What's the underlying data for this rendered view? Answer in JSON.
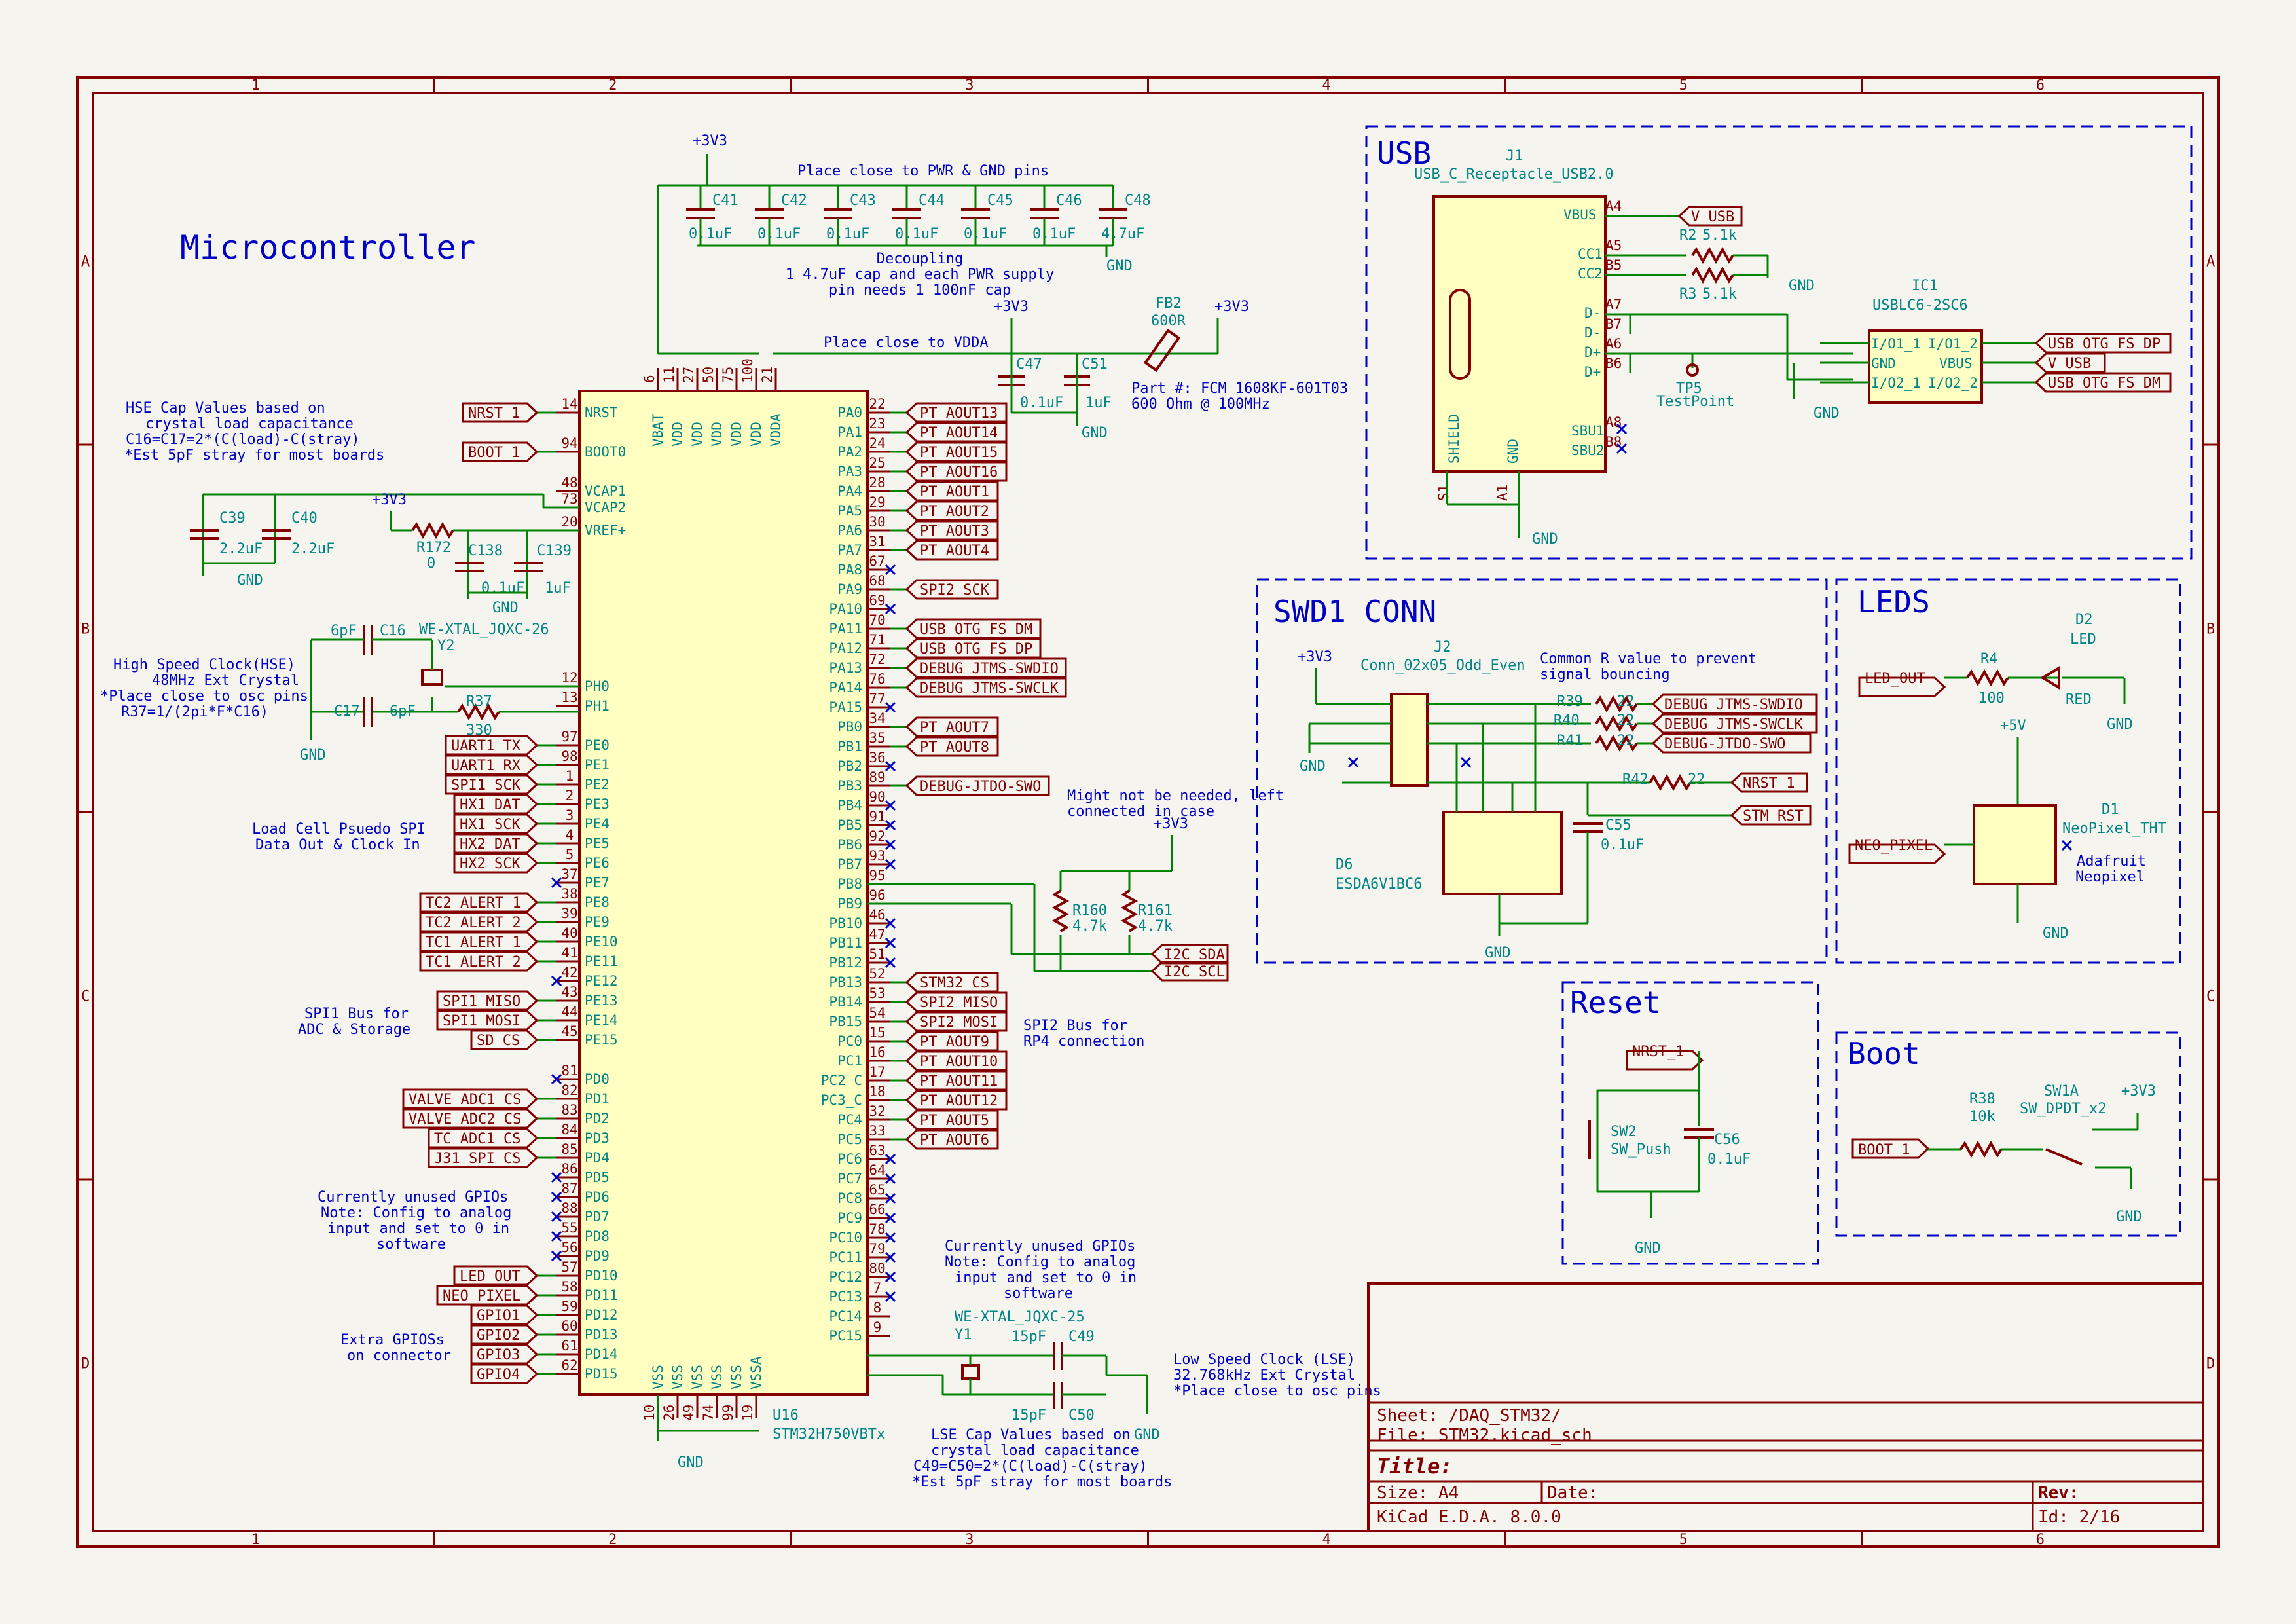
{
  "sheet": {
    "title": "Microcontroller",
    "sheet_line": "Sheet: /DAQ_STM32/",
    "file_line": "File: STM32.kicad_sch",
    "title_label": "Title:",
    "size": "Size: A4",
    "date": "Date:",
    "rev": "Rev:",
    "tool": "KiCad E.D.A. 8.0.0",
    "id": "Id: 2/16"
  },
  "border": {
    "cols": [
      "1",
      "2",
      "3",
      "4",
      "5",
      "6"
    ],
    "rows": [
      "A",
      "B",
      "C",
      "D"
    ]
  },
  "sections": {
    "usb": "USB",
    "swd": "SWD1 CONN",
    "leds": "LEDS",
    "reset": "Reset",
    "boot": "Boot"
  },
  "notes": {
    "place_pwr": "Place close to PWR & GND pins",
    "decoupling": [
      "Decoupling",
      "1 4.7uF cap and each PWR supply",
      "pin needs 1 100nF cap"
    ],
    "place_vdda": "Place close to VDDA",
    "fb_part": [
      "Part #: FCM 1608KF-601T03",
      "600 Ohm @ 100MHz"
    ],
    "hse": [
      "HSE Cap Values based on",
      "crystal load capacitance",
      "C16=C17=2*(C(load)-C(stray)",
      "*Est 5pF stray for most boards"
    ],
    "hs_clock": [
      "High Speed Clock(HSE)",
      "48MHz Ext Crystal",
      "*Place close to osc pins",
      "R37=1/(2pi*F*C16)"
    ],
    "loadcell": [
      "Load Cell Psuedo SPI",
      "Data Out & Clock In"
    ],
    "spi1": [
      "SPI1 Bus for",
      "ADC & Storage"
    ],
    "unused_left": [
      "Currently unused GPIOs",
      "Note: Config to analog",
      "input and set to 0 in",
      "software"
    ],
    "extra": [
      "Extra GPIOSs",
      "on connector"
    ],
    "unused_right": [
      "Currently unused GPIOs",
      "Note: Config to analog",
      "input and set to 0 in",
      "software"
    ],
    "might": [
      "Might not be needed, left",
      "connected in case"
    ],
    "spi2": [
      "SPI2 Bus for",
      "RP4 connection"
    ],
    "lse": [
      "Low Speed Clock (LSE)",
      "32.768kHz Ext Crystal",
      "*Place close to osc pins"
    ],
    "lse_caps": [
      "LSE Cap Values based on",
      "crystal load capacitance",
      "C49=C50=2*(C(load)-C(stray)",
      "*Est 5pF stray for most boards"
    ],
    "common_r": [
      "Common R value to prevent",
      "signal bouncing"
    ]
  },
  "mcu": {
    "ref": "U16",
    "value": "STM32H750VBTx",
    "top_pins": [
      [
        "6",
        "VBAT"
      ],
      [
        "11",
        "VDD"
      ],
      [
        "27",
        "VDD"
      ],
      [
        "50",
        "VDD"
      ],
      [
        "75",
        "VDD"
      ],
      [
        "100",
        "VDD"
      ],
      [
        "21",
        "VDDA"
      ]
    ],
    "bottom_pins": [
      [
        "10",
        "VSS"
      ],
      [
        "26",
        "VSS"
      ],
      [
        "49",
        "VSS"
      ],
      [
        "74",
        "VSS"
      ],
      [
        "99",
        "VSS"
      ],
      [
        "19",
        "VSSA"
      ]
    ],
    "left_pins": [
      [
        "14",
        "NRST"
      ],
      [
        "94",
        "BOOT0"
      ],
      [
        "48",
        "VCAP1"
      ],
      [
        "73",
        "VCAP2"
      ],
      [
        "20",
        "VREF+"
      ],
      [
        "12",
        "PH0"
      ],
      [
        "13",
        "PH1"
      ],
      [
        "97",
        "PE0"
      ],
      [
        "98",
        "PE1"
      ],
      [
        "1",
        "PE2"
      ],
      [
        "2",
        "PE3"
      ],
      [
        "3",
        "PE4"
      ],
      [
        "4",
        "PE5"
      ],
      [
        "5",
        "PE6"
      ],
      [
        "37",
        "PE7"
      ],
      [
        "38",
        "PE8"
      ],
      [
        "39",
        "PE9"
      ],
      [
        "40",
        "PE10"
      ],
      [
        "41",
        "PE11"
      ],
      [
        "42",
        "PE12"
      ],
      [
        "43",
        "PE13"
      ],
      [
        "44",
        "PE14"
      ],
      [
        "45",
        "PE15"
      ],
      [
        "81",
        "PD0"
      ],
      [
        "82",
        "PD1"
      ],
      [
        "83",
        "PD2"
      ],
      [
        "84",
        "PD3"
      ],
      [
        "85",
        "PD4"
      ],
      [
        "86",
        "PD5"
      ],
      [
        "87",
        "PD6"
      ],
      [
        "88",
        "PD7"
      ],
      [
        "55",
        "PD8"
      ],
      [
        "56",
        "PD9"
      ],
      [
        "57",
        "PD10"
      ],
      [
        "58",
        "PD11"
      ],
      [
        "59",
        "PD12"
      ],
      [
        "60",
        "PD13"
      ],
      [
        "61",
        "PD14"
      ],
      [
        "62",
        "PD15"
      ]
    ],
    "right_pins": [
      [
        "22",
        "PA0"
      ],
      [
        "23",
        "PA1"
      ],
      [
        "24",
        "PA2"
      ],
      [
        "25",
        "PA3"
      ],
      [
        "28",
        "PA4"
      ],
      [
        "29",
        "PA5"
      ],
      [
        "30",
        "PA6"
      ],
      [
        "31",
        "PA7"
      ],
      [
        "67",
        "PA8"
      ],
      [
        "68",
        "PA9"
      ],
      [
        "69",
        "PA10"
      ],
      [
        "70",
        "PA11"
      ],
      [
        "71",
        "PA12"
      ],
      [
        "72",
        "PA13"
      ],
      [
        "76",
        "PA14"
      ],
      [
        "77",
        "PA15"
      ],
      [
        "34",
        "PB0"
      ],
      [
        "35",
        "PB1"
      ],
      [
        "36",
        "PB2"
      ],
      [
        "89",
        "PB3"
      ],
      [
        "90",
        "PB4"
      ],
      [
        "91",
        "PB5"
      ],
      [
        "92",
        "PB6"
      ],
      [
        "93",
        "PB7"
      ],
      [
        "95",
        "PB8"
      ],
      [
        "96",
        "PB9"
      ],
      [
        "46",
        "PB10"
      ],
      [
        "47",
        "PB11"
      ],
      [
        "51",
        "PB12"
      ],
      [
        "52",
        "PB13"
      ],
      [
        "53",
        "PB14"
      ],
      [
        "54",
        "PB15"
      ],
      [
        "15",
        "PC0"
      ],
      [
        "16",
        "PC1"
      ],
      [
        "17",
        "PC2_C"
      ],
      [
        "18",
        "PC3_C"
      ],
      [
        "32",
        "PC4"
      ],
      [
        "33",
        "PC5"
      ],
      [
        "63",
        "PC6"
      ],
      [
        "64",
        "PC7"
      ],
      [
        "65",
        "PC8"
      ],
      [
        "66",
        "PC9"
      ],
      [
        "78",
        "PC10"
      ],
      [
        "79",
        "PC11"
      ],
      [
        "80",
        "PC12"
      ],
      [
        "7",
        "PC13"
      ],
      [
        "8",
        "PC14"
      ],
      [
        "9",
        "PC15"
      ]
    ]
  },
  "left_labels": [
    [
      "NRST_1",
      0
    ],
    [
      "BOOT_1",
      1
    ],
    [
      "UART1_TX",
      7
    ],
    [
      "UART1_RX",
      8
    ],
    [
      "SPI1_SCK",
      9
    ],
    [
      "HX1_DAT",
      10
    ],
    [
      "HX1_SCK",
      11
    ],
    [
      "HX2_DAT",
      12
    ],
    [
      "HX2_SCK",
      13
    ],
    [
      "TC2_ALERT_1",
      15
    ],
    [
      "TC2_ALERT_2",
      16
    ],
    [
      "TC1_ALERT_1",
      17
    ],
    [
      "TC1_ALERT_2",
      18
    ],
    [
      "SPI1_MISO",
      20
    ],
    [
      "SPI1_MOSI",
      21
    ],
    [
      "SD_CS",
      22
    ],
    [
      "VALVE_ADC1_CS",
      24
    ],
    [
      "VALVE_ADC2_CS",
      25
    ],
    [
      "TC_ADC1_CS",
      26
    ],
    [
      "J31_SPI_CS",
      27
    ],
    [
      "LED_OUT",
      33
    ],
    [
      "NEO_PIXEL",
      34
    ],
    [
      "GPIO1",
      35
    ],
    [
      "GPIO2",
      36
    ],
    [
      "GPIO3",
      37
    ],
    [
      "GPIO4",
      38
    ]
  ],
  "right_labels": [
    [
      "PT_AOUT13",
      0
    ],
    [
      "PT_AOUT14",
      1
    ],
    [
      "PT_AOUT15",
      2
    ],
    [
      "PT_AOUT16",
      3
    ],
    [
      "PT_AOUT1",
      4
    ],
    [
      "PT_AOUT2",
      5
    ],
    [
      "PT_AOUT3",
      6
    ],
    [
      "PT_AOUT4",
      7
    ],
    [
      "SPI2_SCK",
      9
    ],
    [
      "USB_OTG_FS_DM",
      11
    ],
    [
      "USB_OTG_FS_DP",
      12
    ],
    [
      "DEBUG_JTMS-SWDIO",
      13
    ],
    [
      "DEBUG_JTMS-SWCLK",
      14
    ],
    [
      "PT_AOUT7",
      16
    ],
    [
      "PT_AOUT8",
      17
    ],
    [
      "DEBUG-JTDO-SWO",
      19
    ],
    [
      "STM32_CS",
      29
    ],
    [
      "SPI2_MISO",
      30
    ],
    [
      "SPI2_MOSI",
      31
    ],
    [
      "PT_AOUT9",
      32
    ],
    [
      "PT_AOUT10",
      33
    ],
    [
      "PT_AOUT11",
      34
    ],
    [
      "PT_AOUT12",
      35
    ],
    [
      "PT_AOUT5",
      36
    ],
    [
      "PT_AOUT6",
      37
    ]
  ],
  "nc_left": [
    14,
    19,
    23,
    28,
    29,
    30,
    31,
    32
  ],
  "nc_right": [
    8,
    10,
    15,
    18,
    20,
    21,
    22,
    23,
    26,
    27,
    28,
    38,
    39,
    40,
    41,
    42,
    43,
    44,
    45
  ],
  "caps_top": [
    [
      "C41",
      "0.1uF"
    ],
    [
      "C42",
      "0.1uF"
    ],
    [
      "C43",
      "0.1uF"
    ],
    [
      "C44",
      "0.1uF"
    ],
    [
      "C45",
      "0.1uF"
    ],
    [
      "C46",
      "0.1uF"
    ],
    [
      "C48",
      "4.7uF"
    ]
  ],
  "power": {
    "p3v3": "+3V3",
    "p5v": "+5V",
    "gnd": "GND"
  },
  "parts": {
    "c47": [
      "C47",
      "0.1uF"
    ],
    "c51": [
      "C51",
      "1uF"
    ],
    "fb2": [
      "FB2",
      "600R"
    ],
    "c39": [
      "C39",
      "2.2uF"
    ],
    "c40": [
      "C40",
      "2.2uF"
    ],
    "r172": [
      "R172",
      "0"
    ],
    "c138": [
      "C138",
      "0.1uF"
    ],
    "c139": [
      "C139",
      "1uF"
    ],
    "c16": [
      "C16",
      "6pF"
    ],
    "c17": [
      "C17",
      "6pF"
    ],
    "y2": [
      "Y2",
      "WE-XTAL_JQXC-26"
    ],
    "r37": [
      "R37",
      "330"
    ],
    "r160": [
      "R160",
      "4.7k"
    ],
    "r161": [
      "R161",
      "4.7k"
    ],
    "i2c_sda": "I2C_SDA",
    "i2c_scl": "I2C_SCL",
    "y1": [
      "Y1",
      "WE-XTAL_JQXC-25"
    ],
    "c49": [
      "C49",
      "15pF"
    ],
    "c50": [
      "C50",
      "15pF"
    ],
    "j1": [
      "J1",
      "USB_C_Receptacle_USB2.0"
    ],
    "r2": [
      "R2",
      "5.1k"
    ],
    "r3": [
      "R3",
      "5.1k"
    ],
    "tp5": [
      "TP5",
      "TestPoint"
    ],
    "ic1": [
      "IC1",
      "USBLC6-2SC6"
    ],
    "j2": [
      "J2",
      "Conn_02x05_Odd_Even"
    ],
    "r39": [
      "R39",
      "22"
    ],
    "r40": [
      "R40",
      "22"
    ],
    "r41": [
      "R41",
      "22"
    ],
    "r42": [
      "R42",
      "22"
    ],
    "c55": [
      "C55",
      "0.1uF"
    ],
    "d6": [
      "D6",
      "ESDA6V1BC6"
    ],
    "d2": [
      "D2",
      "LED"
    ],
    "r4": [
      "R4",
      "100"
    ],
    "red": "RED",
    "d1": [
      "D1",
      "NeoPixel_THT"
    ],
    "adafruit": [
      "Adafruit",
      "Neopixel"
    ],
    "sw2": [
      "SW2",
      "SW_Push"
    ],
    "c56": [
      "C56",
      "0.1uF"
    ],
    "r38": [
      "R38",
      "10k"
    ],
    "sw1": [
      "SW1A",
      "SW_DPDT_x2"
    ]
  },
  "usb_labels": {
    "v_usb": "V_USB",
    "dp": "USB_OTG_FS_DP",
    "vusb": "V_USB",
    "dm": "USB_OTG_FS_DM"
  },
  "j1_pins": {
    "vbus": "VBUS",
    "cc1": "CC1",
    "cc2": "CC2",
    "dm": "D-",
    "dp": "D+",
    "sbu1": "SBU1",
    "sbu2": "SBU2",
    "shield": "SHIELD",
    "gnd": "GND",
    "a4": "A4",
    "a5": "A5",
    "b5": "B5",
    "a7": "A7",
    "b7": "B7",
    "a6": "A6",
    "b6": "B6",
    "a8": "A8",
    "b8": "B8",
    "s1": "S1",
    "a1": "A1"
  },
  "ic1_pins": {
    "l1": "I/O1_1",
    "l2": "GND",
    "l3": "I/O2_1",
    "r1": "I/O1_2",
    "r2": "VBUS",
    "r3": "I/O2_2"
  },
  "swd_labels": {
    "swdio": "DEBUG_JTMS-SWDIO",
    "swclk": "DEBUG_JTMS-SWCLK",
    "swo": "DEBUG-JTDO-SWO",
    "nrst": "NRST_1",
    "stm_rst": "STM_RST"
  },
  "led_labels": {
    "led_out": "LED_OUT",
    "neo": "NEO_PIXEL"
  },
  "reset_labels": {
    "nrst": "NRST_1"
  },
  "boot_labels": {
    "boot": "BOOT_1"
  },
  "colors": {
    "border": "#840000",
    "wire": "#008400",
    "body_fill": "#ffffc2",
    "note": "#0000c4",
    "pin_name": "#008484"
  }
}
